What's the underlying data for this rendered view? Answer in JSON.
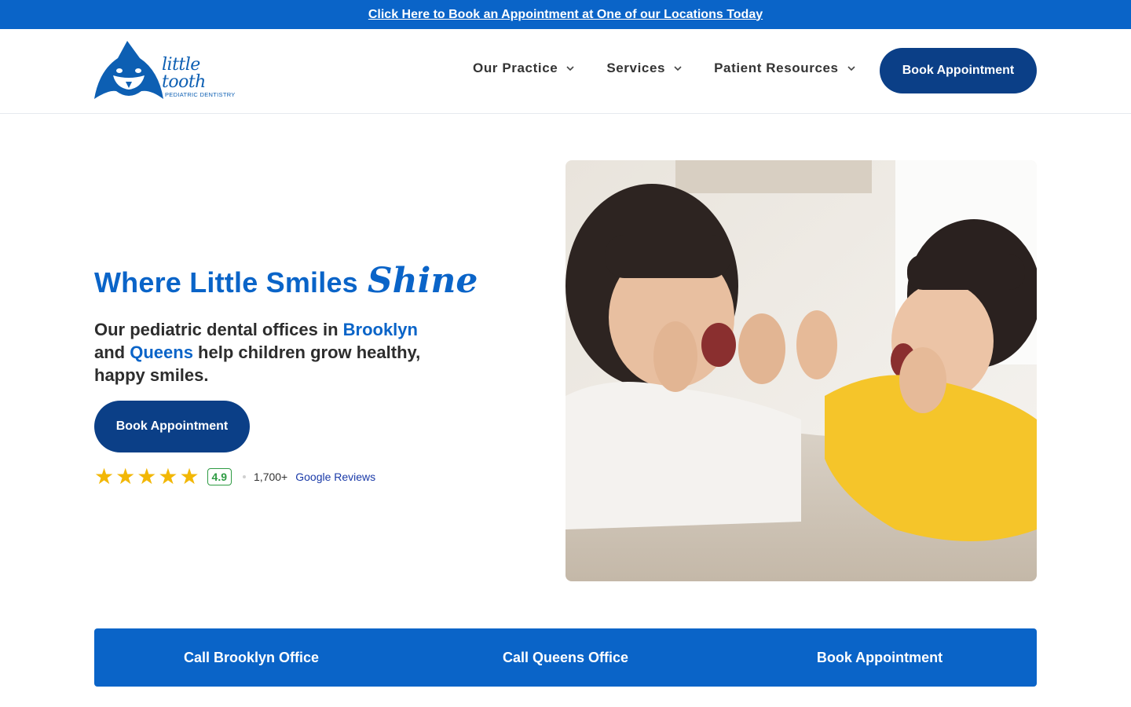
{
  "topbar": {
    "text": "Click Here to Book an Appointment at One of our Locations Today"
  },
  "logo": {
    "name": "little tooth",
    "sub": "PEDIATRIC DENTISTRY"
  },
  "nav": {
    "items": [
      {
        "label": "Our Practice",
        "icon": "chevron-down-icon"
      },
      {
        "label": "Services",
        "icon": "chevron-down-icon"
      },
      {
        "label": "Patient Resources",
        "icon": "chevron-down-icon"
      }
    ],
    "cta": "Book Appointment"
  },
  "hero": {
    "title_main": "Where Little Smiles",
    "title_script": "Shine",
    "sub_part1": "Our pediatric dental offices in ",
    "loc1": "Brooklyn",
    "sub_part2": " and ",
    "loc2": "Queens",
    "sub_part3": " help children grow healthy, happy smiles.",
    "cta": "Book Appointment",
    "rating": {
      "stars": 5,
      "score": "4.9",
      "count": "1,700+",
      "link": "Google Reviews"
    }
  },
  "bottom": {
    "items": [
      "Call Brooklyn Office",
      "Call Queens Office",
      "Book Appointment"
    ]
  },
  "colors": {
    "primary": "#0a64c8",
    "navy": "#0b3f87",
    "star": "#f2b705",
    "rating_green": "#2e9b43"
  }
}
